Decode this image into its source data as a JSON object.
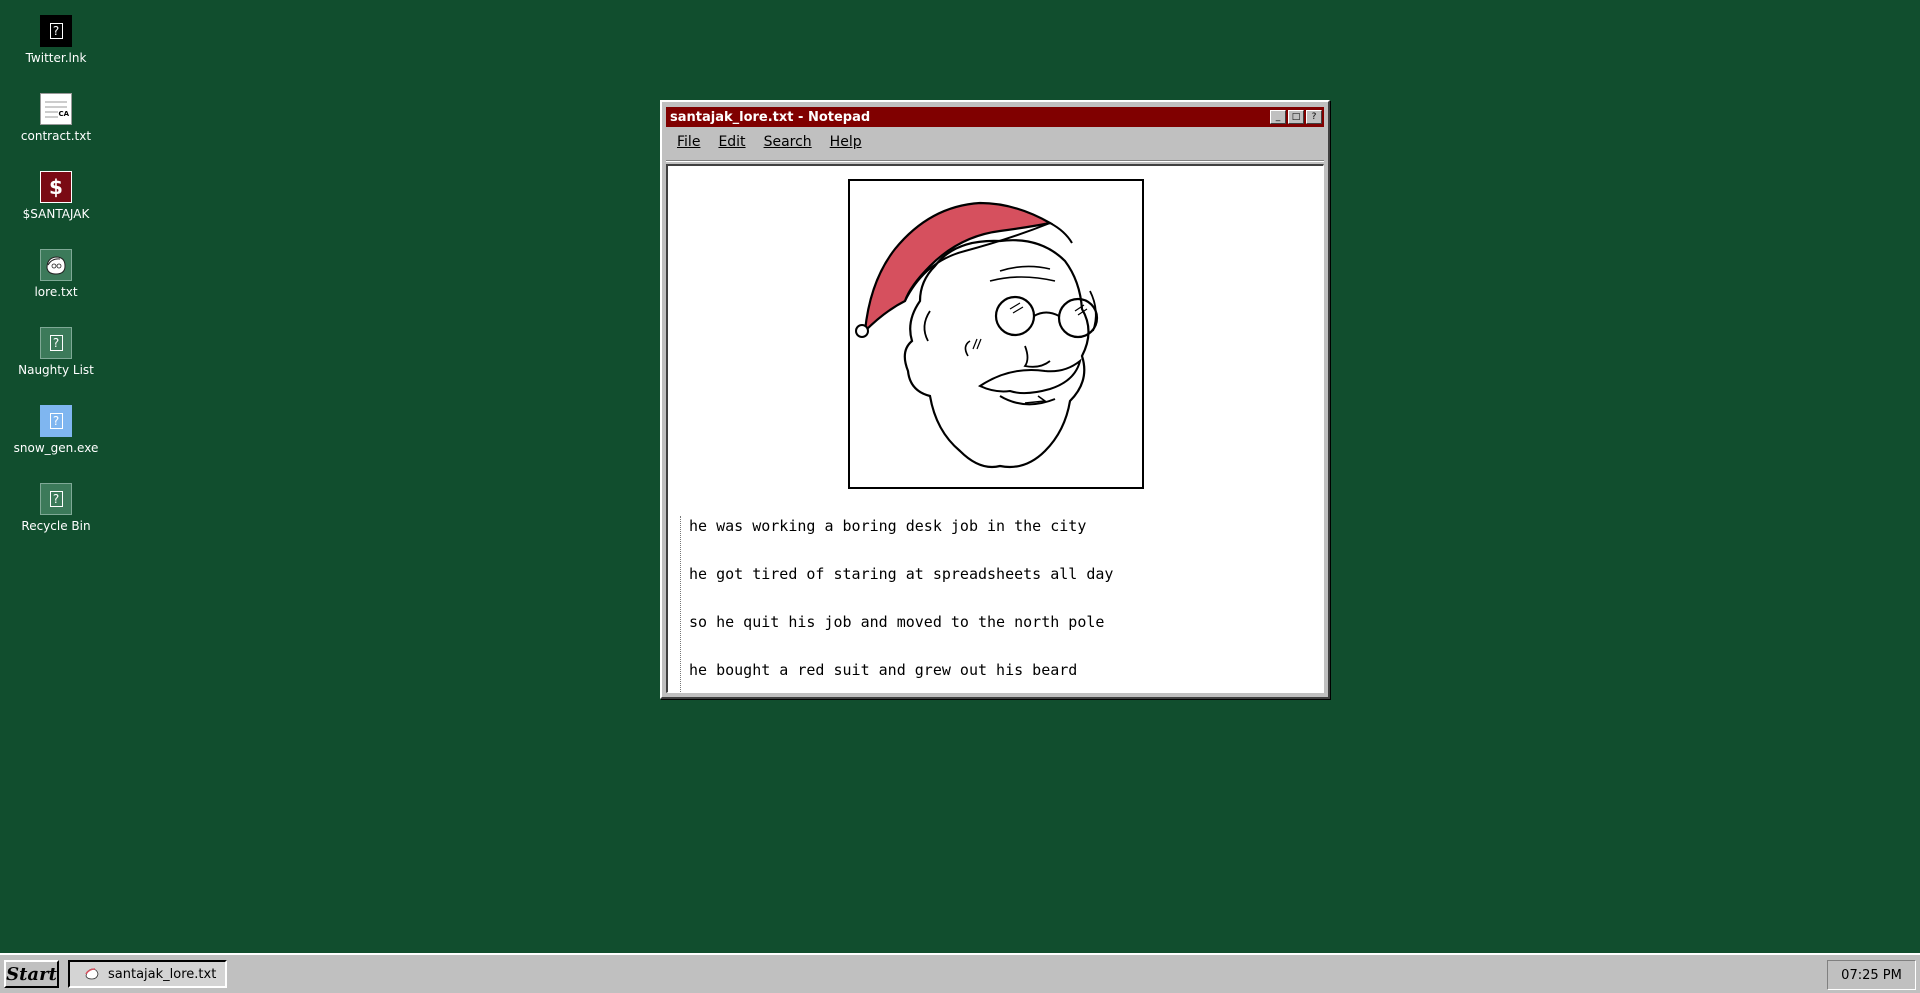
{
  "desktop": {
    "icons": [
      {
        "label": "Twitter.lnk",
        "icon": "unknown-file-icon",
        "bg": "#000000"
      },
      {
        "label": "contract.txt",
        "icon": "document-icon",
        "bg": "#ffffff",
        "glyph": "CA"
      },
      {
        "label": "$SANTAJAK",
        "icon": "dollar-icon",
        "bg": "#7a0a14",
        "glyph": "$"
      },
      {
        "label": "lore.txt",
        "icon": "santa-sketch-icon",
        "bg": "#3c7a5a"
      },
      {
        "label": "Naughty List",
        "icon": "unknown-file-icon",
        "bg": "#3c7a5a"
      },
      {
        "label": "snow_gen.exe",
        "icon": "unknown-file-icon",
        "bg": "#7fb6f0"
      },
      {
        "label": "Recycle Bin",
        "icon": "unknown-file-icon",
        "bg": "#3c7a5a"
      }
    ]
  },
  "window": {
    "title": "santajak_lore.txt - Notepad",
    "controls": {
      "minimize": "_",
      "maximize": "□",
      "close": "?"
    },
    "menu": [
      "File",
      "Edit",
      "Search",
      "Help"
    ],
    "image": {
      "name": "santa-face-sketch",
      "hat_color": "#d6505e"
    },
    "lines": [
      "he was working a boring desk job in the city",
      "he got tired of staring at spreadsheets all day",
      "so he quit his job and moved to the north pole",
      "he bought a red suit and grew out his beard"
    ]
  },
  "taskbar": {
    "start_label": "Start",
    "task_label": "santajak_lore.txt",
    "clock": "07:25 PM"
  },
  "colors": {
    "desktop": "#114e2e",
    "titlebar": "#800000",
    "chrome": "#c0c0c0"
  }
}
